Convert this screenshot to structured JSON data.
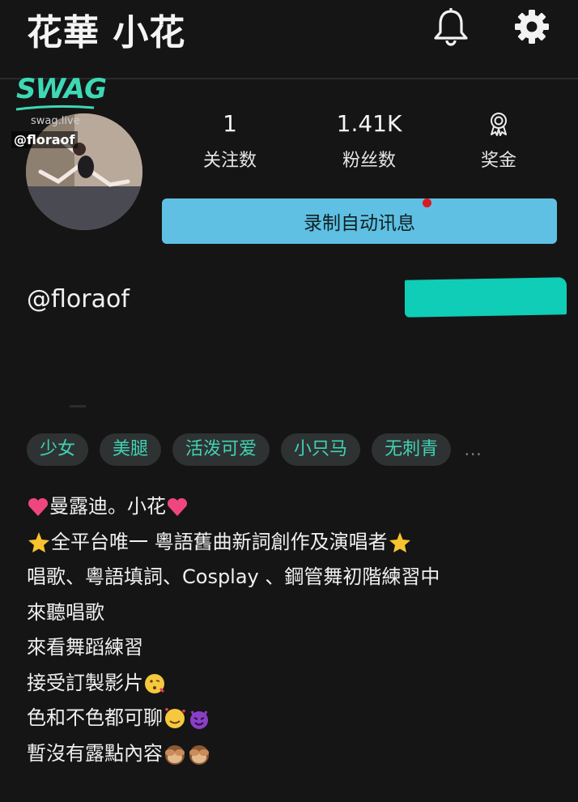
{
  "header": {
    "title": "花華 小花",
    "notification_icon": "bell-icon",
    "settings_icon": "gear-icon"
  },
  "watermark": {
    "logo": "SWAG",
    "site": "swag.live",
    "handle": "@floraof"
  },
  "stats": [
    {
      "value": "1",
      "label": "关注数"
    },
    {
      "value": "1.41K",
      "label": "粉丝数"
    },
    {
      "icon": "award-icon",
      "label": "奖金"
    }
  ],
  "cta": {
    "label": "录制自动讯息",
    "dot_color": "#d81a22"
  },
  "profile": {
    "username": "@floraof"
  },
  "tags": [
    "少女",
    "美腿",
    "活泼可爱",
    "小只马",
    "无刺青"
  ],
  "tags_more": "…",
  "bio": {
    "line1": "曼露迪。小花",
    "line2": "全平台唯一 粵語舊曲新詞創作及演唱者",
    "line3": "唱歌、粵語填詞、Cosplay 、鋼管舞初階練習中",
    "line4": "來聽唱歌",
    "line5": "來看舞蹈練習",
    "line6": "接受訂製影片",
    "line7": "色和不色都可聊",
    "line8": "暫沒有露點內容"
  },
  "colors": {
    "background": "#151515",
    "accent_teal": "#3fd3b6",
    "cta_blue": "#5fc0e4"
  }
}
